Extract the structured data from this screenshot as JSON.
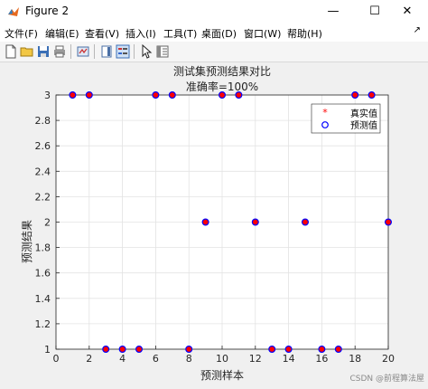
{
  "window": {
    "title": "Figure 2",
    "controls": {
      "minimize": "—",
      "maximize": "☐",
      "close": "✕"
    }
  },
  "menu": {
    "items": [
      "文件(F)",
      "编辑(E)",
      "查看(V)",
      "插入(I)",
      "工具(T)",
      "桌面(D)",
      "窗口(W)",
      "帮助(H)"
    ]
  },
  "toolbar": {
    "icons": [
      "new-figure-icon",
      "open-file-icon",
      "save-icon",
      "print-icon",
      "link-plot-icon",
      "insert-colorbar-icon",
      "insert-legend-icon",
      "edit-plot-arrow-icon",
      "property-inspector-icon"
    ]
  },
  "watermark": "CSDN @前程算法屋",
  "chart_data": {
    "type": "scatter",
    "title": "测试集预测结果对比",
    "subtitle": "准确率=100%",
    "xlabel": "预测样本",
    "ylabel": "预测结果",
    "xlim": [
      0,
      20
    ],
    "ylim": [
      1,
      3
    ],
    "xticks": [
      "0",
      "2",
      "4",
      "6",
      "8",
      "10",
      "12",
      "14",
      "16",
      "18",
      "20"
    ],
    "yticks": [
      "1",
      "1.2",
      "1.4",
      "1.6",
      "1.8",
      "2",
      "2.2",
      "2.4",
      "2.6",
      "2.8",
      "3"
    ],
    "grid": true,
    "legend_position": "top-right",
    "x": [
      1,
      2,
      3,
      4,
      5,
      6,
      7,
      8,
      9,
      10,
      11,
      12,
      13,
      14,
      15,
      16,
      17,
      18,
      19,
      20
    ],
    "series": [
      {
        "name": "真实值",
        "marker": "star",
        "color": "#ff0000",
        "values": [
          3,
          3,
          1,
          1,
          1,
          3,
          3,
          1,
          2,
          3,
          3,
          2,
          1,
          1,
          2,
          1,
          1,
          3,
          3,
          2
        ]
      },
      {
        "name": "预测值",
        "marker": "circle",
        "color": "#0000ff",
        "values": [
          3,
          3,
          1,
          1,
          1,
          3,
          3,
          1,
          2,
          3,
          3,
          2,
          1,
          1,
          2,
          1,
          1,
          3,
          3,
          2
        ]
      }
    ]
  }
}
